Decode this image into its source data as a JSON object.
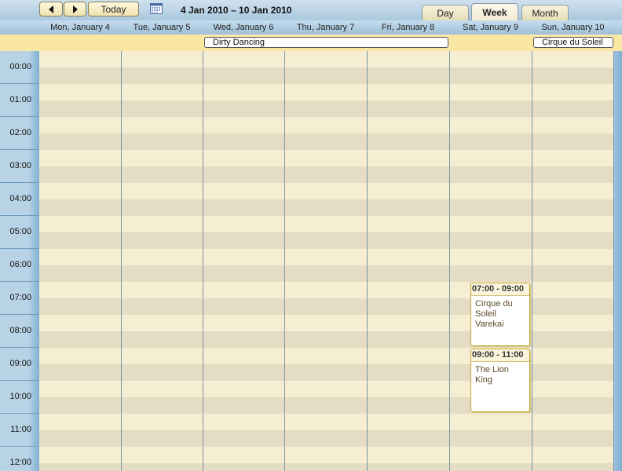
{
  "toolbar": {
    "today_label": "Today",
    "date_range": "4 Jan 2010 – 10 Jan 2010",
    "views": [
      "Day",
      "Week",
      "Month"
    ],
    "active_view": "Week"
  },
  "days": [
    "Mon, January 4",
    "Tue, January 5",
    "Wed, January 6",
    "Thu, January 7",
    "Fri, January 8",
    "Sat, January 9",
    "Sun, January 10"
  ],
  "allday_events": [
    {
      "title": "Dirty Dancing"
    },
    {
      "title": "Cirque du Soleil"
    }
  ],
  "hours": [
    "00:00",
    "01:00",
    "02:00",
    "03:00",
    "04:00",
    "05:00",
    "06:00",
    "07:00",
    "08:00",
    "09:00",
    "10:00",
    "11:00",
    "12:00"
  ],
  "events": [
    {
      "time": "07:00 - 09:00",
      "title": "Cirque du Soleil Varekai"
    },
    {
      "time": "09:00 - 11:00",
      "title": "The Lion King"
    }
  ],
  "colors": {
    "header_blue": "#a9c8de",
    "allday_yellow": "#fbe7a4",
    "grid_light": "#f5eed3",
    "grid_dark": "#e4dcc3",
    "event_border": "#c4a636"
  }
}
